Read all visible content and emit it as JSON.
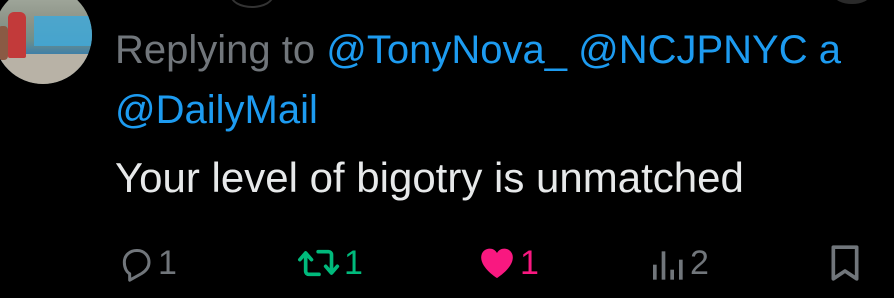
{
  "reply_context": {
    "prefix": "Replying to ",
    "mention_1": "@TonyNova_",
    "mention_2": "@NCJPNYC",
    "connector": " a",
    "mention_3": "@DailyMail"
  },
  "tweet": {
    "text": "Your level of bigotry is unmatched"
  },
  "actions": {
    "reply_count": "1",
    "retweet_count": "1",
    "like_count": "1",
    "views_count": "2"
  },
  "colors": {
    "background": "#000000",
    "text": "#e7e9ea",
    "muted": "#71767b",
    "link": "#1d9bf0",
    "retweet_active": "#00ba7c",
    "like_active": "#f91880"
  },
  "icons": {
    "reply": "reply-icon",
    "retweet": "retweet-icon",
    "like": "heart-icon",
    "views": "views-icon",
    "bookmark": "bookmark-icon"
  }
}
